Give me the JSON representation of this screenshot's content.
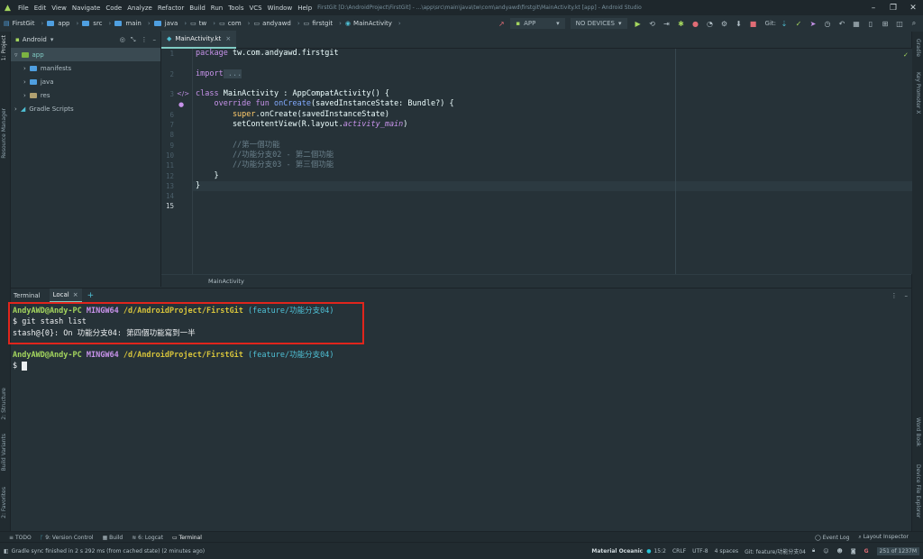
{
  "menubar": {
    "items": [
      "File",
      "Edit",
      "View",
      "Navigate",
      "Code",
      "Analyze",
      "Refactor",
      "Build",
      "Run",
      "Tools",
      "VCS",
      "Window",
      "Help"
    ],
    "title": "FirstGit [D:\\AndroidProject\\FirstGit] - ...\\app\\src\\main\\java\\tw\\com\\andyawd\\firstgit\\MainActivity.kt [app] - Android Studio"
  },
  "navbar": {
    "crumbs": [
      "FirstGit",
      "app",
      "src",
      "main",
      "java",
      "tw",
      "com",
      "andyawd",
      "firstgit",
      "MainActivity"
    ],
    "run_config": "APP",
    "device": "NO DEVICES",
    "git_label": "Git:"
  },
  "project": {
    "view": "Android",
    "tree": [
      "app",
      "manifests",
      "java",
      "res",
      "Gradle Scripts"
    ]
  },
  "editor": {
    "tab": "MainActivity.kt",
    "line_numbers": [
      "1",
      "2",
      "3",
      "6",
      "7",
      "8",
      "9",
      "10",
      "11",
      "12",
      "13",
      "14",
      "15"
    ],
    "breadcrumb": "MainActivity",
    "code": {
      "l1_kw": "package",
      "l1_rest": " tw.com.andyawd.firstgit",
      "l3_kw": "import",
      "l3_fold": " ...",
      "l6_kw": "class",
      "l6_rest": " MainActivity : AppCompatActivity() {",
      "l7_kw": "    override fun",
      "l7_fn": " onCreate",
      "l7_rest": "(savedInstanceState: Bundle?) {",
      "l8_fo": "        super",
      "l8_rest": ".onCreate(savedInstanceState)",
      "l9_rest": "        setContentView(R.layout.",
      "l9_it": "activity_main",
      "l9_end": ")",
      "l11": "        //第一個功能",
      "l12": "        //功能分支02 - 第二個功能",
      "l13": "        //功能分支03 - 第三個功能",
      "l14": "    }",
      "l15": "}"
    }
  },
  "terminal": {
    "tab_title": "Terminal",
    "session": "Local",
    "prompt_user": "AndyAWD@Andy-PC",
    "prompt_host": "MINGW64",
    "prompt_path": "/d/AndroidProject/FirstGit",
    "prompt_branch": "(feature/功能分支04)",
    "command": "$ git stash list",
    "output": "stash@{0}: On 功能分支04: 第四個功能寫到一半",
    "dollar": "$"
  },
  "left_tools": [
    "1: Project",
    "Resource Manager",
    "2: Structure",
    "Build Variants",
    "2: Favorites"
  ],
  "right_tools": [
    "Gradle",
    "Key Promoter X",
    "Word Book",
    "Device File Explorer"
  ],
  "bottom_tools": [
    "TODO",
    "9: Version Control",
    "Build",
    "6: Logcat",
    "Terminal"
  ],
  "bottom_right_tools": [
    "Event Log",
    "Layout Inspector"
  ],
  "status": {
    "message": "Gradle sync finished in 2 s 292 ms (from cached state) (2 minutes ago)",
    "theme": "Material Oceanic",
    "position": "15:2",
    "line_sep": "CRLF",
    "encoding": "UTF-8",
    "indent": "4 spaces",
    "branch": "Git: feature/功能分支04",
    "memory": "251 of 1237M"
  },
  "colors": {
    "background": "#263238",
    "accent": "#80cbc4",
    "highlight_box": "#e0251c"
  }
}
